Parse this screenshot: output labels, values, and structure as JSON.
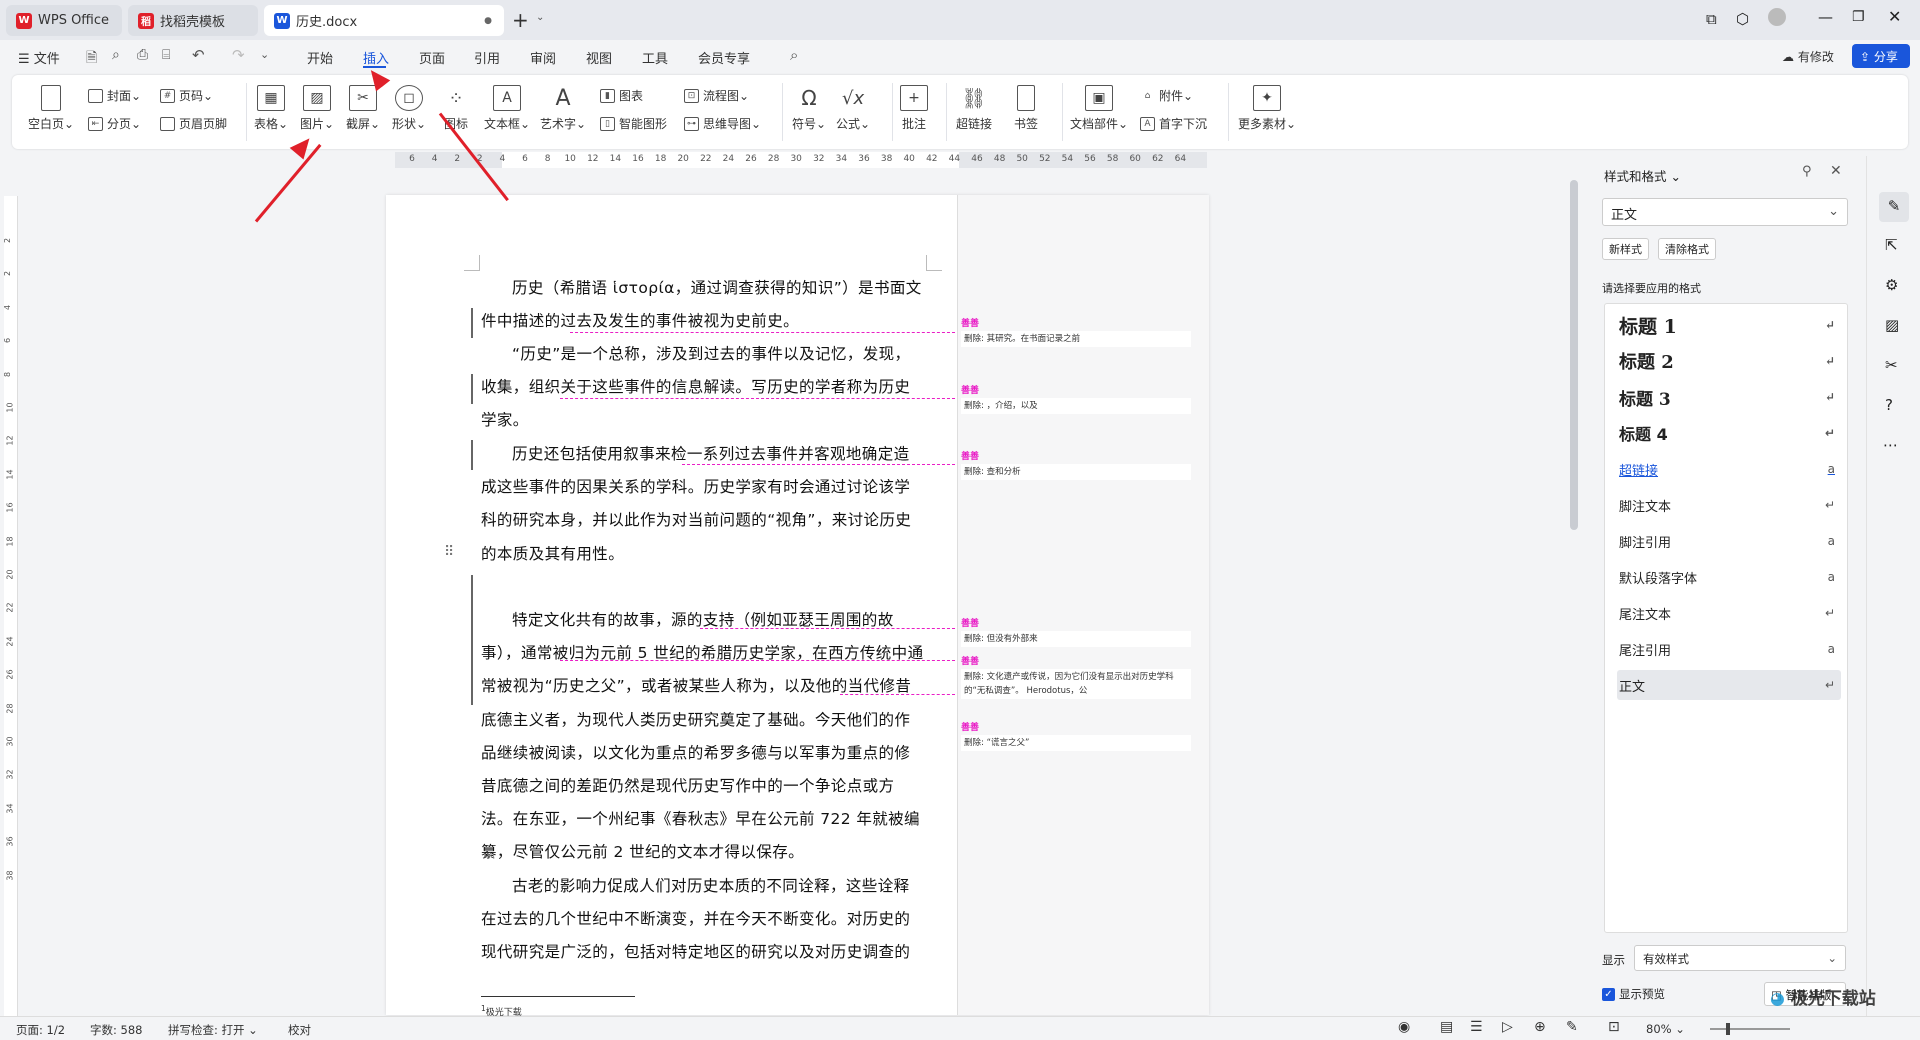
{
  "tabs": [
    {
      "label": "WPS Office",
      "logo": "W"
    },
    {
      "label": "找稻壳模板",
      "logo": "稻"
    },
    {
      "label": "历史.docx",
      "logo": "W"
    }
  ],
  "new_tab": "+",
  "menu": {
    "file": "文件",
    "items": [
      "开始",
      "插入",
      "页面",
      "引用",
      "审阅",
      "视图",
      "工具",
      "会员专享"
    ],
    "active": "插入",
    "modify": "有修改",
    "share": "分享"
  },
  "ribbon": {
    "blank_page": "空白页",
    "cover": "封面",
    "page_break": "分页",
    "page_num": "页码",
    "header_footer": "页眉页脚",
    "table": "表格",
    "picture": "图片",
    "screenshot": "截屏",
    "shape": "形状",
    "icon": "图标",
    "textbox": "文本框",
    "arttext": "艺术字",
    "chart": "图表",
    "smart_graphic": "智能图形",
    "flowchart": "流程图",
    "mindmap": "思维导图",
    "symbol": "符号",
    "formula": "公式",
    "comment": "批注",
    "hyperlink": "超链接",
    "bookmark": "书签",
    "doc_parts": "文档部件",
    "attachment": "附件",
    "drop_cap": "首字下沉",
    "more": "更多素材"
  },
  "ruler": {
    "ticks": [
      "6",
      "4",
      "2",
      "2",
      "4",
      "6",
      "8",
      "10",
      "12",
      "14",
      "16",
      "18",
      "20",
      "22",
      "24",
      "26",
      "28",
      "30",
      "32",
      "34",
      "36",
      "38",
      "40",
      "42",
      "44",
      "46",
      "48",
      "50",
      "52",
      "54",
      "56",
      "58",
      "60",
      "62",
      "64"
    ],
    "vticks": [
      "2",
      "2",
      "4",
      "6",
      "8",
      "10",
      "12",
      "14",
      "16",
      "18",
      "20",
      "22",
      "24",
      "26",
      "28",
      "30",
      "32",
      "34",
      "36",
      "38"
    ]
  },
  "doc": {
    "p1": "历史（希腊语 ἱστορία，通过调查获得的知识”）是书面文件中描述的过去及发生的事件被视为史前史。",
    "p2": "“历史”是一个总称，涉及到过去的事件以及记忆，发现，收集，组织关于这些事件的信息解读。写历史的学者称为历史学家。",
    "p3": "历史还包括使用叙事来检一系列过去事件并客观地确定造成这些事件的因果关系的学科。历史学家有时会通过讨论该学科的研究本身，并以此作为对当前问题的“视角”，来讨论历史的本质及其有用性。",
    "p4": "特定文化共有的故事，源的支持（例如亚瑟王周围的故事），通常被归为元前 5 世纪的希腊历史学家，在西方传统中通常被视为“历史之父”，或者被某些人称为，以及他的当代修昔底德主义者，为现代人类历史研究奠定了基础。今天他们的作品继续被阅读，以文化为重点的希罗多德与以军事为重点的修昔底德之间的差距仍然是现代历史写作中的一个争论点或方法。在东亚，一个州纪事《春秋志》早在公元前 722 年就被编纂，尽管仅公元前 2 世纪的文本才得以保存。",
    "p5": "古老的影响力促成人们对历史本质的不同诠释，这些诠释在过去的几个世纪中不断演变，并在今天不断变化。对历史的现代研究是广泛的，包括对特定地区的研究以及对历史调查的某些主",
    "footnote": "极光下载",
    "footnote_mark": "1"
  },
  "comments": [
    {
      "author": "善善",
      "text": "删除: 其研究。在书面记录之前"
    },
    {
      "author": "善善",
      "text": "删除: ，介绍，以及"
    },
    {
      "author": "善善",
      "text": "删除: 查和分析"
    },
    {
      "author": "善善",
      "text": "删除: 但没有外部来"
    },
    {
      "author": "善善",
      "text": "删除: 文化遗产或传说，因为它们没有显示出对历史学科的“无私调查”。 Herodotus，公"
    },
    {
      "author": "善善",
      "text": "删除: “谎言之父”"
    }
  ],
  "panel": {
    "title": "样式和格式",
    "current": "正文",
    "new_style": "新样式",
    "clear": "清除格式",
    "hint": "请选择要应用的格式",
    "styles": [
      {
        "name": "标题 1",
        "sym": "↵"
      },
      {
        "name": "标题 2",
        "sym": "↵"
      },
      {
        "name": "标题 3",
        "sym": "↵"
      },
      {
        "name": "标题 4",
        "sym": "↵"
      },
      {
        "name": "超链接",
        "sym": "a"
      },
      {
        "name": "脚注文本",
        "sym": "↵"
      },
      {
        "name": "脚注引用",
        "sym": "a"
      },
      {
        "name": "默认段落字体",
        "sym": "a"
      },
      {
        "name": "尾注文本",
        "sym": "↵"
      },
      {
        "name": "尾注引用",
        "sym": "a"
      },
      {
        "name": "正文",
        "sym": "↵"
      }
    ],
    "show_label": "显示",
    "show_value": "有效样式",
    "preview_label": "显示预览",
    "smart": "智能排版"
  },
  "status": {
    "page": "页面: 1/2",
    "words": "字数: 588",
    "spell": "拼写检查: 打开",
    "proof": "校对",
    "zoom": "80%"
  },
  "watermark": "极光下载站",
  "colors": {
    "accent": "#1a56db",
    "comment": "#e91ec6",
    "arrow": "#e0202a"
  }
}
